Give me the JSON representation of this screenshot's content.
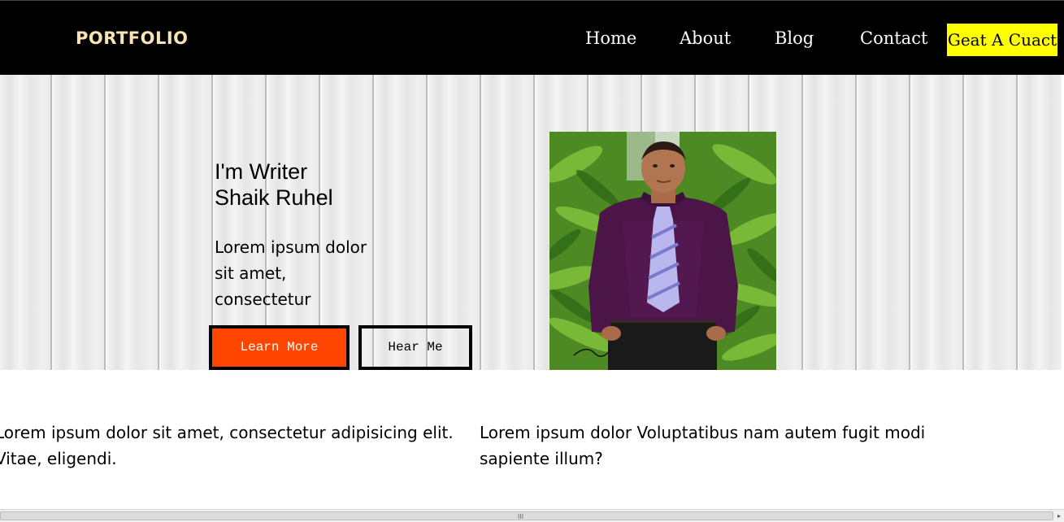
{
  "navbar": {
    "logo": "PORTFOLIO",
    "links": [
      "Home",
      "About",
      "Blog",
      "Contact"
    ],
    "cta_label": "Geat A Cuact",
    "background": "#000000",
    "cta_color": "#ffff00"
  },
  "hero": {
    "role": "I'm Writer",
    "name": "Shaik Ruhel",
    "text": "Lorem ipsum dolor sit amet, consectetur",
    "learn_more_label": "Learn More",
    "hear_me_label": "Hear Me",
    "learn_more_color": "#ff4500"
  },
  "columns": {
    "left": "Lorem ipsum dolor sit amet, consectetur adipisicing elit. Vitae, eligendi.",
    "right": "Lorem ipsum dolor Voluptatibus nam autem fugit modi sapiente illum?"
  },
  "scrollbar": {
    "grip": "III",
    "arrow": "▸"
  }
}
